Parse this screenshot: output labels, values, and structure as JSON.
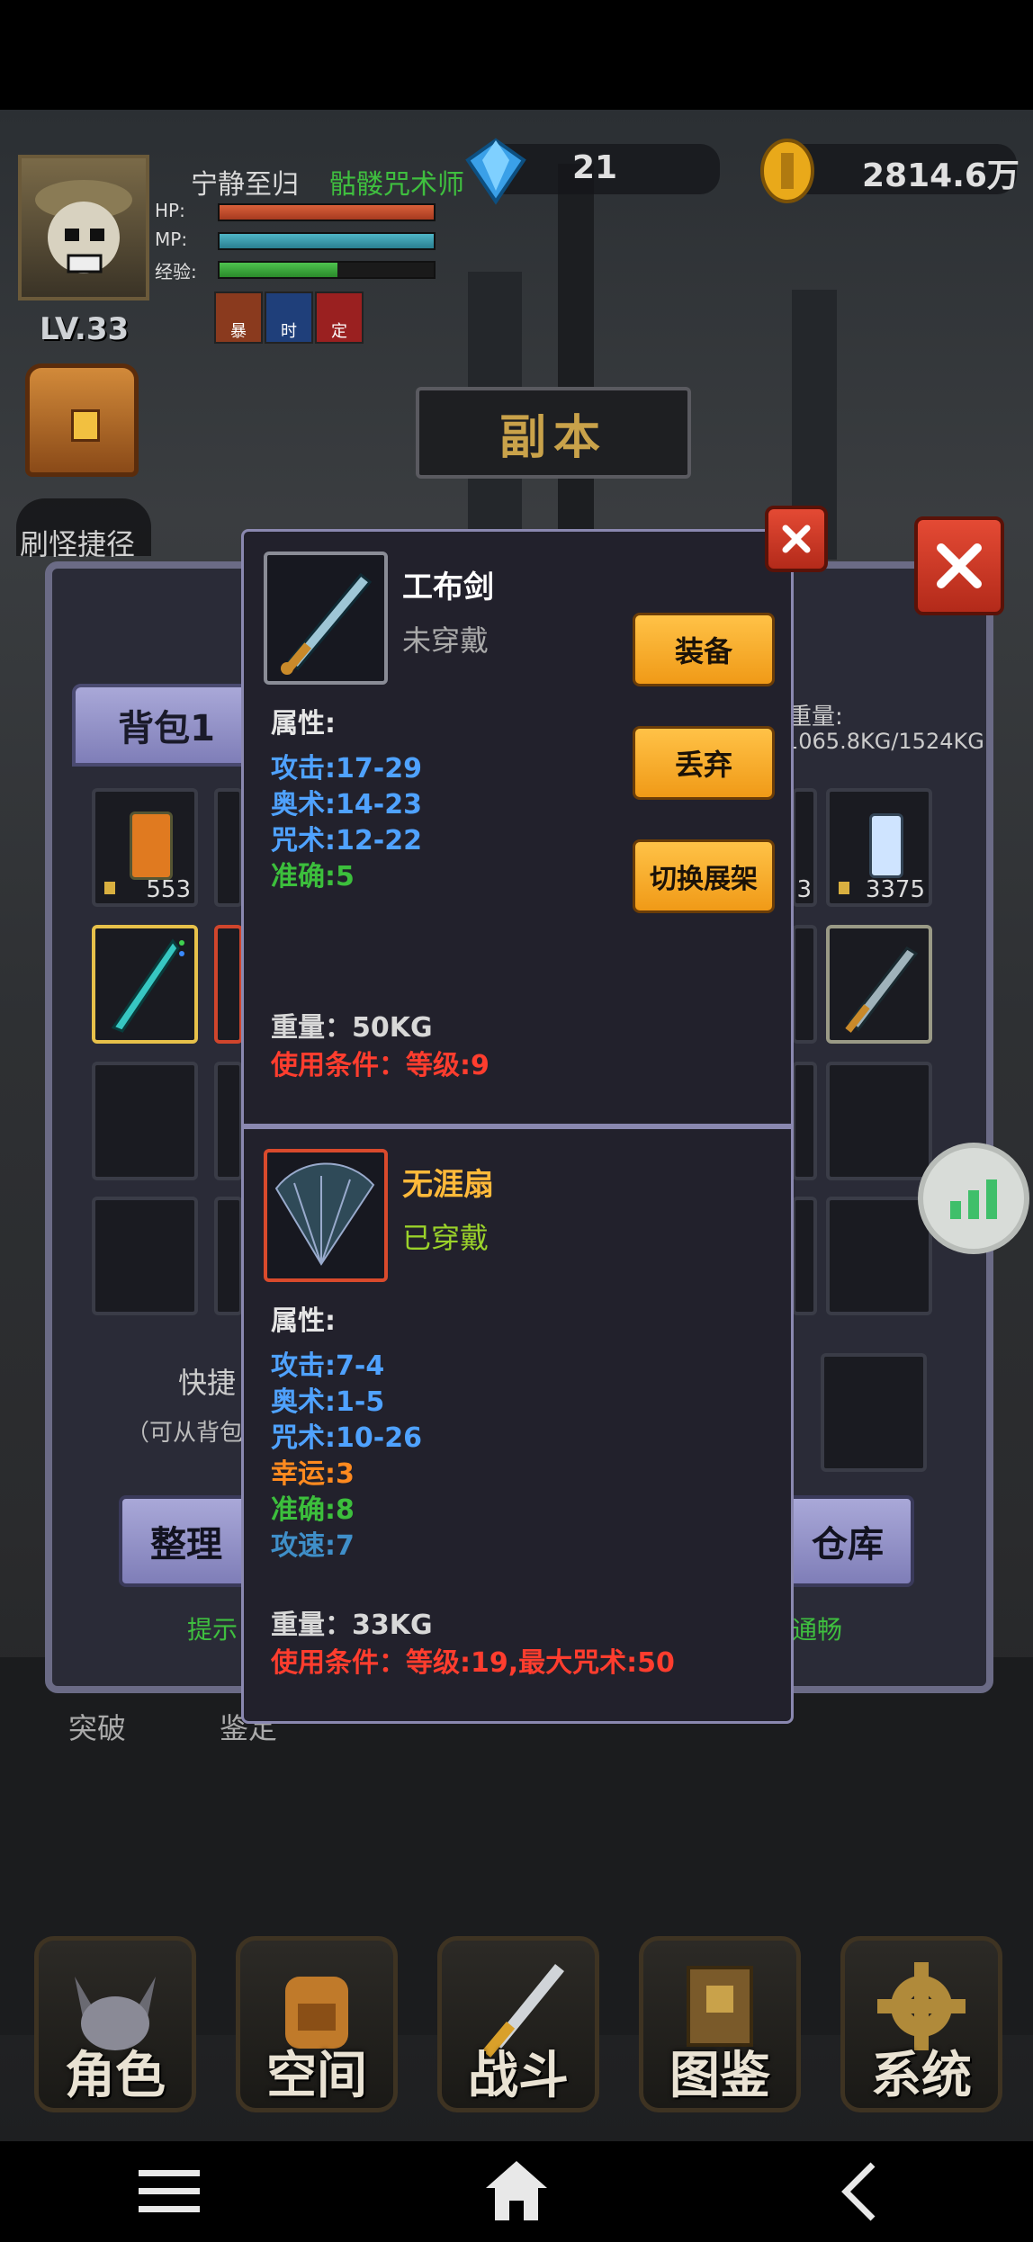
{
  "player": {
    "name": "宁静至归",
    "class_name": "骷髅咒术师",
    "level": "LV.33",
    "hp_label": "HP:",
    "mp_label": "MP:",
    "exp_label": "经验:",
    "hp_fill": 1.0,
    "mp_fill": 1.0,
    "exp_fill": 0.55,
    "buffs": [
      "暴",
      "时",
      "定"
    ]
  },
  "currency": {
    "gems": "21",
    "gold": "2814.6万"
  },
  "shortcut_label": "刷怪捷径",
  "dungeon_label": "副本",
  "bag": {
    "tab_label": "背包1",
    "weight_label": "重量:",
    "weight_value": "1065.8KG/1524KG",
    "slot_count_left": "553",
    "slot_count_right": "3375",
    "slot_count_right_partial": "3",
    "quick_label": "快捷",
    "quick_hint": "（可从背包",
    "sort_button": "整理",
    "warehouse_button": "仓库",
    "tip_left": "提示",
    "tip_right": "通畅",
    "below_left": "突破",
    "below_mid": "鉴定"
  },
  "item_popup": {
    "name": "工布剑",
    "status": "未穿戴",
    "attr_label": "属性:",
    "stats": [
      {
        "text": "攻击:17-29",
        "color": "#4fa2ff"
      },
      {
        "text": "奥术:14-23",
        "color": "#4fa2ff"
      },
      {
        "text": "咒术:12-22",
        "color": "#4fa2ff"
      },
      {
        "text": "准确:5",
        "color": "#3cbf3c"
      }
    ],
    "weight": "重量：50KG",
    "requirement": "使用条件：等级:9",
    "equip_button": "装备",
    "discard_button": "丢弃",
    "switch_button": "切换展架"
  },
  "equipped_popup": {
    "name": "无涯扇",
    "status": "已穿戴",
    "attr_label": "属性:",
    "stats": [
      {
        "text": "攻击:7-4",
        "color": "#4fa2ff"
      },
      {
        "text": "奥术:1-5",
        "color": "#4fa2ff"
      },
      {
        "text": "咒术:10-26",
        "color": "#4fa2ff"
      },
      {
        "text": "幸运:3",
        "color": "#ff8a1f"
      },
      {
        "text": "准确:8",
        "color": "#3cbf3c"
      },
      {
        "text": "攻速:7",
        "color": "#3f8fc9"
      }
    ],
    "weight": "重量：33KG",
    "requirement": "使用条件：等级:19,最大咒术:50"
  },
  "bottom_nav": [
    "角色",
    "空间",
    "战斗",
    "图鉴",
    "系统"
  ],
  "icons": {
    "close": "close-icon",
    "stats_float": "bar-chart-icon",
    "menu": "menu-icon",
    "home": "home-icon",
    "back": "back-icon"
  },
  "colors": {
    "name_yellow": "#ffb93a",
    "equipped_green": "#9bd22a",
    "req_red": "#ff3d2e",
    "class_green": "#3fbf3f",
    "popup_bg": "#22212c"
  }
}
